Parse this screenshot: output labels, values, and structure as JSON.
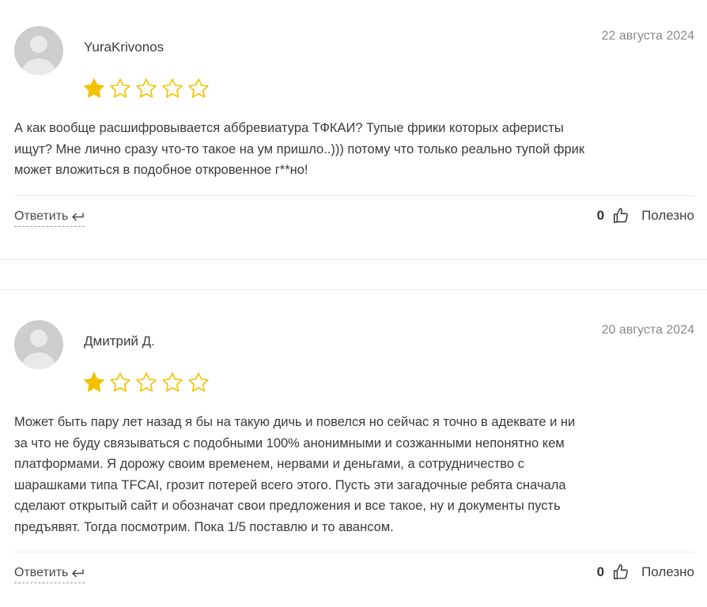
{
  "colors": {
    "star_filled": "#f2c200",
    "star_outline": "#f2c200",
    "avatar_bg": "#cdcdcd"
  },
  "reviews": [
    {
      "author": "YuraKrivonos",
      "date": "22 августа 2024",
      "rating": 1,
      "max_rating": 5,
      "text_lines": [
        "А как вообще расшифровывается аббревиатура ТФКАИ? Тупые фрики которых аферисты",
        "ищут? Мне лично сразу что-то такое на ум пришло..))) потому что только реально тупой фрик",
        "может вложиться в подобное откровенное г**но!"
      ],
      "reply_label": "Ответить",
      "helpful_count": "0",
      "helpful_label": "Полезно",
      "icons": {
        "avatar": "user-avatar-icon",
        "reply": "reply-arrow-icon",
        "like": "thumbs-up-icon"
      }
    },
    {
      "author": "Дмитрий Д.",
      "date": "20 августа 2024",
      "rating": 1,
      "max_rating": 5,
      "text_lines": [
        "Может быть пару лет назад я бы на такую дичь и повелся но сейчас я точно в адеквате и ни",
        "за что не буду связываться с подобными 100% анонимными и созжанными непонятно кем",
        "платформами. Я дорожу своим временем, нервами и деньгами, а сотрудничество с",
        "шарашками типа TFCAI, грозит потерей всего этого. Пусть эти загадочные ребята сначала",
        "сделают открытый сайт и обозначат свои предложения и все такое, ну и документы пусть",
        "предъявят. Тогда посмотрим. Пока 1/5 поставлю и то авансом."
      ],
      "reply_label": "Ответить",
      "helpful_count": "0",
      "helpful_label": "Полезно",
      "icons": {
        "avatar": "user-avatar-icon",
        "reply": "reply-arrow-icon",
        "like": "thumbs-up-icon"
      }
    }
  ]
}
